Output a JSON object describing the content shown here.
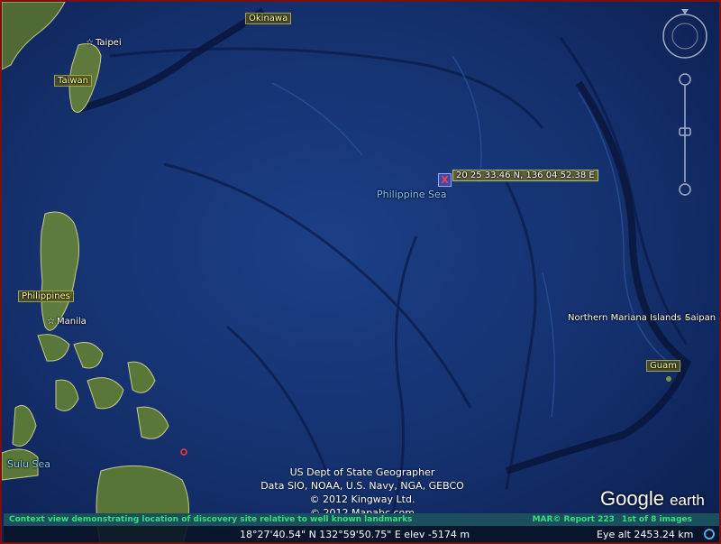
{
  "places": {
    "okinawa": "Okinawa",
    "taipei": "Taipei",
    "taiwan": "Taiwan",
    "philippines": "Philippines",
    "manila": "Manila",
    "sulu_sea": "Sulu Sea",
    "philippine_sea": "Philippine Sea",
    "northern_mariana": "Northern Mariana Islands",
    "saipan": "Saipan",
    "guam": "Guam"
  },
  "marker": {
    "symbol": "X",
    "coordinate_label": "20 25 33.46 N, 136 04 52.38 E"
  },
  "attribution": [
    "US Dept of State Geographer",
    "Data SIO, NOAA, U.S. Navy, NGA, GEBCO",
    "© 2012 Kingway Ltd.",
    "© 2012 Mapabc.com"
  ],
  "caption": "Context view demonstrating location of discovery site relative to well known landmarks",
  "report": "MAR© Report 223",
  "image_count": "1st of 8 images",
  "status": {
    "pointer_coords": "18°27'40.54\" N 132°59'50.75\" E elev -5174 m",
    "eye_alt": "Eye alt 2453.24 km"
  },
  "logo": {
    "google": "Google",
    "earth": "earth"
  },
  "colors": {
    "ocean": "#13306e",
    "trench": "#0a1b4c",
    "land": "#5c7a3a",
    "tag": "#ffff9a",
    "caption": "#2fe07a",
    "frame": "#7a0f12"
  },
  "icons": [
    "star-icon",
    "x-marker-icon",
    "compass-ring-icon",
    "zoom-slider-icon",
    "progress-ring-icon"
  ]
}
